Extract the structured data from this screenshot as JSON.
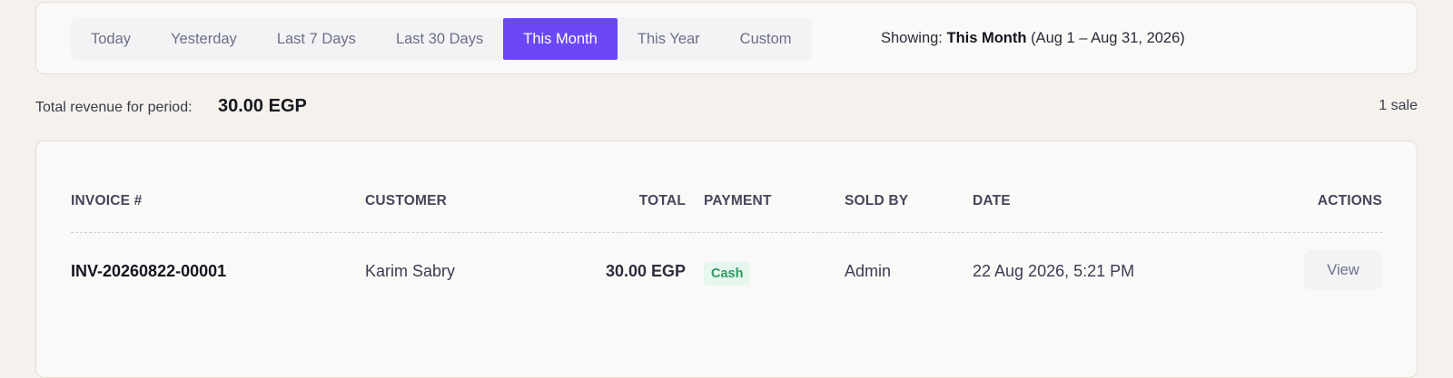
{
  "filters": {
    "options": [
      "Today",
      "Yesterday",
      "Last 7 Days",
      "Last 30 Days",
      "This Month",
      "This Year",
      "Custom"
    ],
    "active": "This Month",
    "showing_label": "Showing:",
    "showing_value": "This Month",
    "showing_range": "(Aug 1 – Aug 31, 2026)"
  },
  "summary": {
    "label": "Total revenue for period:",
    "value": "30.00 EGP",
    "count": "1 sale"
  },
  "table": {
    "headers": {
      "invoice": "INVOICE #",
      "customer": "CUSTOMER",
      "total": "TOTAL",
      "payment": "PAYMENT",
      "sold_by": "SOLD BY",
      "date": "DATE",
      "actions": "ACTIONS"
    },
    "rows": [
      {
        "invoice": "INV-20260822-00001",
        "customer": "Karim Sabry",
        "total": "30.00 EGP",
        "payment": "Cash",
        "sold_by": "Admin",
        "date": "22 Aug 2026, 5:21 PM",
        "action": "View"
      }
    ]
  },
  "colors": {
    "accent": "#6c47f5",
    "badge_bg": "#e6f7ee",
    "badge_text": "#2f9a63"
  }
}
